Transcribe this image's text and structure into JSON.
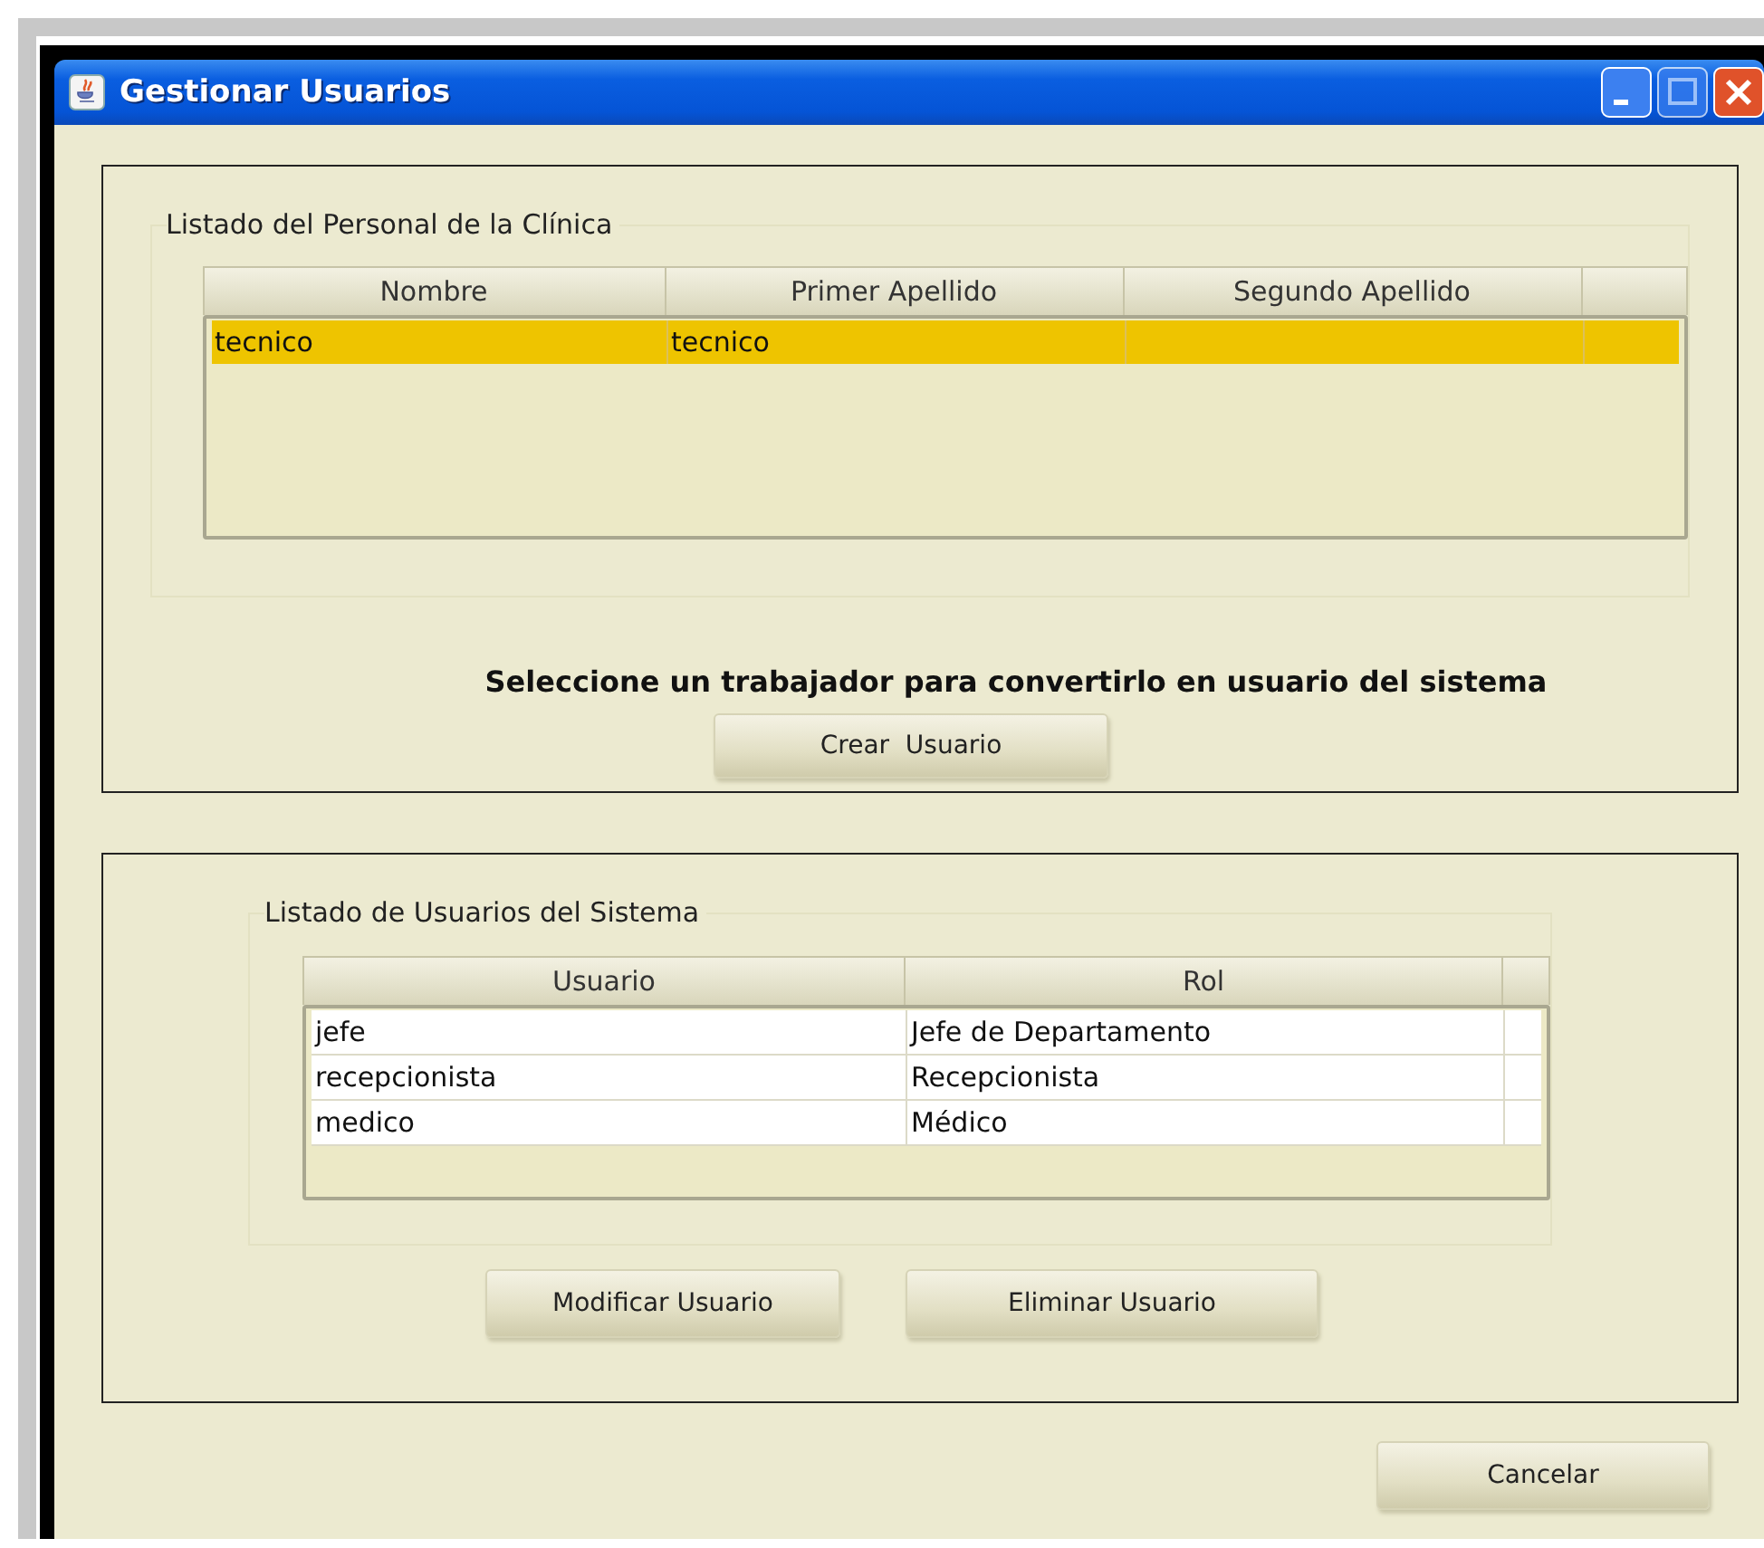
{
  "window": {
    "title": "Gestionar Usuarios"
  },
  "staff_panel": {
    "title": "Listado del Personal de la Clínica",
    "table": {
      "columns": [
        "Nombre",
        "Primer Apellido",
        "Segundo Apellido"
      ],
      "rows": [
        {
          "cells": [
            "tecnico",
            "tecnico",
            ""
          ],
          "selected": true
        }
      ]
    },
    "instruction": "Seleccione un trabajador para convertirlo en usuario del sistema",
    "buttons": [
      "Crear  Usuario"
    ]
  },
  "users_panel": {
    "title": "Listado de Usuarios del Sistema",
    "table": {
      "columns": [
        "Usuario",
        "Rol"
      ],
      "rows": [
        {
          "cells": [
            "jefe",
            "Jefe  de Departamento"
          ],
          "selected": false
        },
        {
          "cells": [
            "recepcionista",
            "Recepcionista"
          ],
          "selected": false
        },
        {
          "cells": [
            "medico",
            "Médico"
          ],
          "selected": false
        }
      ]
    },
    "buttons": [
      "Modificar Usuario",
      "Eliminar Usuario"
    ]
  },
  "footer_buttons": [
    "Cancelar"
  ]
}
